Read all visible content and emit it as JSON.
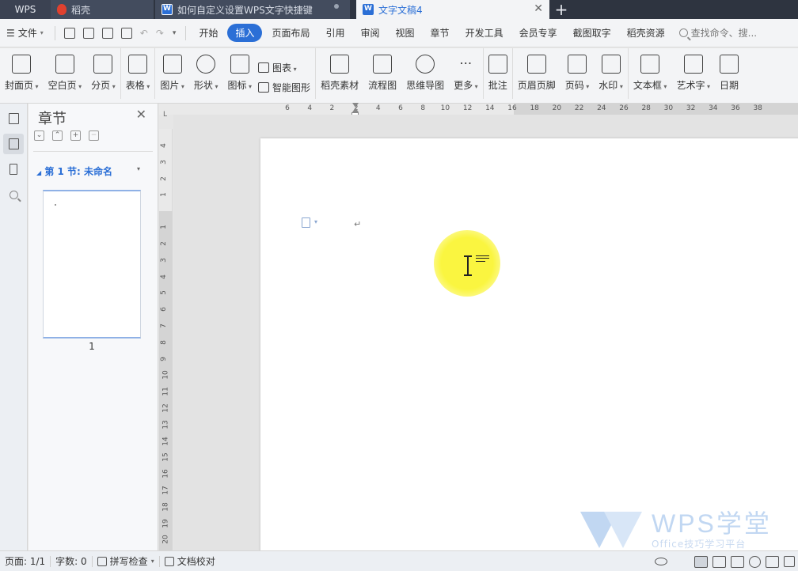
{
  "titlebar": {
    "app_label": "WPS",
    "tabs": [
      {
        "label": "稻壳"
      },
      {
        "label": "如何自定义设置WPS文字快捷键"
      },
      {
        "label": "文字文稿4"
      }
    ],
    "close_glyph": "✕",
    "add_glyph": "+"
  },
  "menubar": {
    "file_label": "文件",
    "items": [
      "开始",
      "插入",
      "页面布局",
      "引用",
      "审阅",
      "视图",
      "章节",
      "开发工具",
      "会员专享",
      "截图取字",
      "稻壳资源"
    ],
    "active_item": "插入",
    "search_placeholder": "查找命令、搜..."
  },
  "ribbon": {
    "cover": "封面页",
    "blank": "空白页",
    "pagebreak": "分页",
    "table": "表格",
    "picture": "图片",
    "shape": "形状",
    "icon": "图标",
    "chart": "图表",
    "smart_graphic": "智能图形",
    "docer_material": "稻壳素材",
    "flowchart": "流程图",
    "mindmap": "思维导图",
    "more": "更多",
    "comment": "批注",
    "header_footer": "页眉页脚",
    "page_number": "页码",
    "watermark": "水印",
    "textbox": "文本框",
    "wordart": "艺术字",
    "date": "日期"
  },
  "pane": {
    "title": "章节",
    "section_label": "第 1 节: 未命名",
    "page_number": "1"
  },
  "ruler": {
    "h_ticks": [
      "6",
      "4",
      "2",
      "2",
      "4",
      "6",
      "8",
      "10",
      "12",
      "14",
      "16",
      "18",
      "20",
      "22",
      "24",
      "26",
      "28",
      "30",
      "32",
      "34",
      "36",
      "38"
    ],
    "v_ticks": [
      "4",
      "3",
      "2",
      "1",
      "1",
      "2",
      "3",
      "4",
      "5",
      "6",
      "7",
      "8",
      "9",
      "10",
      "11",
      "12",
      "13",
      "14",
      "15",
      "16",
      "17",
      "18",
      "19",
      "20"
    ],
    "corner_mark": "L"
  },
  "document": {
    "paragraph_mark": "↵"
  },
  "watermark_brand": {
    "title": "WPS学堂",
    "subtitle": "Office技巧学习平台"
  },
  "status": {
    "page": "页面: 1/1",
    "words": "字数: 0",
    "spell": "拼写检查",
    "proof": "文档校对"
  },
  "colors": {
    "accent": "#2b6fd6",
    "highlight": "#f8f23c",
    "titlebar": "#2e3440"
  }
}
